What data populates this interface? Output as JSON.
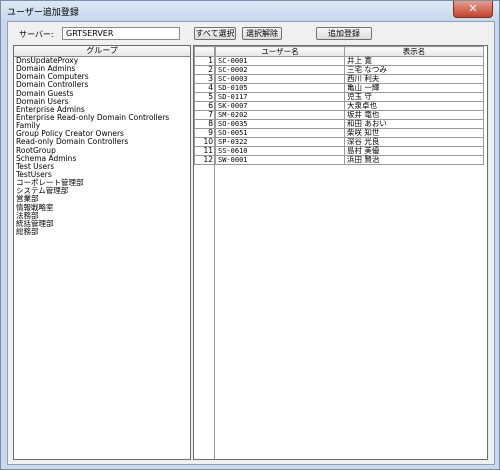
{
  "window": {
    "title": "ユーザー追加登録",
    "close": "✕"
  },
  "server": {
    "label": "サーバー:",
    "value": "GRTSERVER"
  },
  "buttons": {
    "select_all": "すべて選択",
    "deselect": "選択解除",
    "add": "追加登録"
  },
  "groups": {
    "header": "グループ",
    "items": [
      "DnsUpdateProxy",
      "Domain Admins",
      "Domain Computers",
      "Domain Controllers",
      "Domain Guests",
      "Domain Users",
      "Enterprise Admins",
      "Enterprise Read-only Domain Controllers",
      "Family",
      "Group Policy Creator Owners",
      "Read-only Domain Controllers",
      "RootGroup",
      "Schema Admins",
      "Test Users",
      "TestUsers",
      "コーポレート管理部",
      "システム管理部",
      "営業部",
      "情報戦略室",
      "法務部",
      "統括管理部",
      "総務部"
    ]
  },
  "users": {
    "headers": [
      "",
      "ユーザー名",
      "表示名"
    ],
    "rows": [
      [
        "1",
        "SC-0001",
        "井上 寛"
      ],
      [
        "2",
        "SC-0002",
        "三宅 なつみ"
      ],
      [
        "3",
        "SC-0003",
        "西川 利夫"
      ],
      [
        "4",
        "SD-0105",
        "亀山 一輝"
      ],
      [
        "5",
        "SD-0117",
        "児玉 守"
      ],
      [
        "6",
        "SK-0007",
        "大泉卓也"
      ],
      [
        "7",
        "SM-0202",
        "坂井 竜也"
      ],
      [
        "8",
        "SO-0035",
        "和田 あおい"
      ],
      [
        "9",
        "SO-0051",
        "柴咲 知世"
      ],
      [
        "10",
        "SP-0322",
        "深谷 光良"
      ],
      [
        "11",
        "SS-0610",
        "島村 美優"
      ],
      [
        "12",
        "SW-0001",
        "浜田 賢治"
      ]
    ]
  }
}
